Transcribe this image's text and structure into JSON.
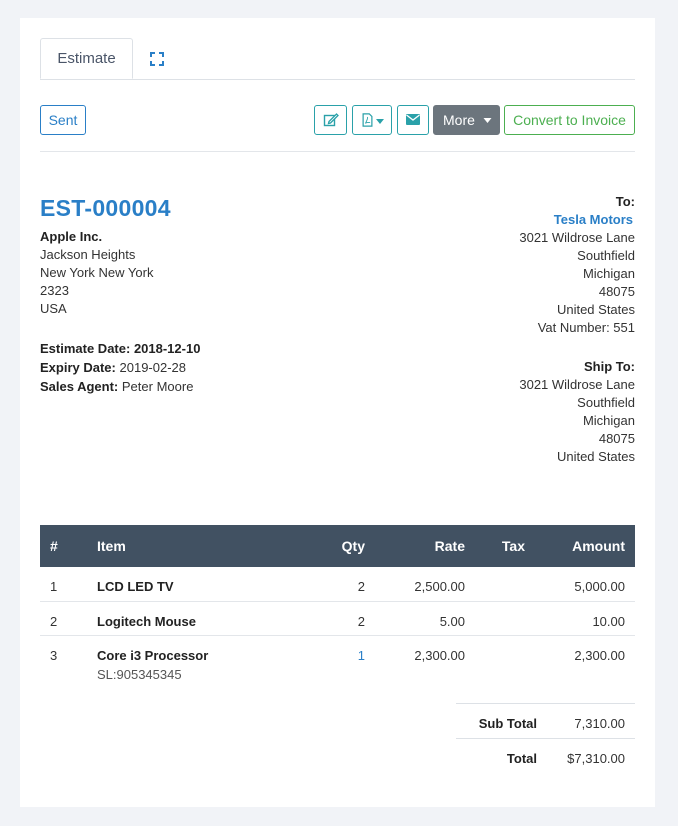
{
  "tabs": {
    "estimate": "Estimate"
  },
  "toolbar": {
    "sent": "Sent",
    "more": "More",
    "convert": "Convert to Invoice"
  },
  "estimate": {
    "number": "EST-000004",
    "from": {
      "name": "Apple Inc.",
      "line1": "Jackson Heights",
      "line2": "New York New York",
      "line3": "2323",
      "line4": "USA"
    },
    "dates": {
      "estimate_label": "Estimate Date:",
      "estimate_value": "2018-12-10",
      "expiry_label": "Expiry Date:",
      "expiry_value": "2019-02-28",
      "agent_label": "Sales Agent:",
      "agent_value": "Peter Moore"
    },
    "to": {
      "label": "To:",
      "company": "Tesla Motors",
      "street": "3021 Wildrose Lane",
      "city": "Southfield",
      "state": "Michigan",
      "zip": "48075",
      "country": "United States",
      "vat": "Vat Number: 551"
    },
    "ship": {
      "label": "Ship To:",
      "street": "3021 Wildrose Lane",
      "city": "Southfield",
      "state": "Michigan",
      "zip": "48075",
      "country": "United States"
    }
  },
  "table": {
    "headers": {
      "num": "#",
      "item": "Item",
      "qty": "Qty",
      "rate": "Rate",
      "tax": "Tax",
      "amount": "Amount"
    },
    "rows": [
      {
        "num": "1",
        "item": "LCD LED TV",
        "sub": "",
        "qty": "2",
        "rate": "2,500.00",
        "tax": "",
        "amount": "5,000.00"
      },
      {
        "num": "2",
        "item": "Logitech Mouse",
        "sub": "",
        "qty": "2",
        "rate": "5.00",
        "tax": "",
        "amount": "10.00"
      },
      {
        "num": "3",
        "item": "Core i3 Processor",
        "sub": "SL:905345345",
        "qty": "1",
        "rate": "2,300.00",
        "tax": "",
        "amount": "2,300.00"
      }
    ]
  },
  "totals": {
    "sub_label": "Sub Total",
    "sub_value": "7,310.00",
    "total_label": "Total",
    "total_value": "$7,310.00"
  },
  "colors": {
    "primary": "#2a7fc7",
    "teal": "#2aa1a9",
    "success": "#4caf50",
    "header": "#415162"
  }
}
